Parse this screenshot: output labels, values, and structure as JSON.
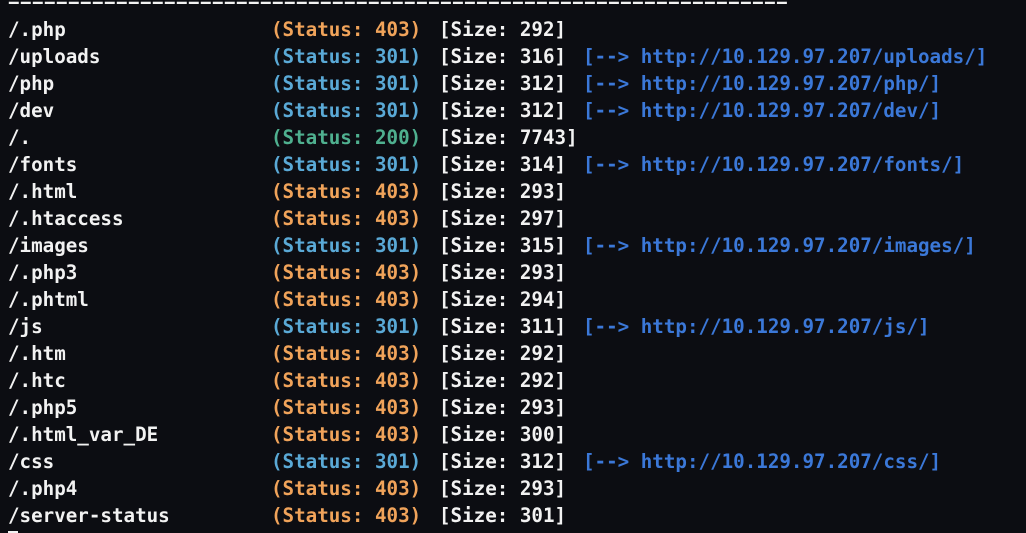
{
  "terminal": {
    "separator": "=================================================================",
    "colors": {
      "background": "#0c0d12",
      "text": "#f2f2f2",
      "status_403": "#f0a35a",
      "status_301": "#5aa9d6",
      "status_200": "#4fb08f",
      "redirect": "#3b78d8"
    },
    "rows": [
      {
        "path": "/.php",
        "status": "(Status: 403)",
        "code": "403",
        "size": "[Size: 292]",
        "redirect": ""
      },
      {
        "path": "/uploads",
        "status": "(Status: 301)",
        "code": "301",
        "size": "[Size: 316]",
        "redirect": "[--> http://10.129.97.207/uploads/]"
      },
      {
        "path": "/php",
        "status": "(Status: 301)",
        "code": "301",
        "size": "[Size: 312]",
        "redirect": "[--> http://10.129.97.207/php/]"
      },
      {
        "path": "/dev",
        "status": "(Status: 301)",
        "code": "301",
        "size": "[Size: 312]",
        "redirect": "[--> http://10.129.97.207/dev/]"
      },
      {
        "path": "/.",
        "status": "(Status: 200)",
        "code": "200",
        "size": "[Size: 7743]",
        "redirect": ""
      },
      {
        "path": "/fonts",
        "status": "(Status: 301)",
        "code": "301",
        "size": "[Size: 314]",
        "redirect": "[--> http://10.129.97.207/fonts/]"
      },
      {
        "path": "/.html",
        "status": "(Status: 403)",
        "code": "403",
        "size": "[Size: 293]",
        "redirect": ""
      },
      {
        "path": "/.htaccess",
        "status": "(Status: 403)",
        "code": "403",
        "size": "[Size: 297]",
        "redirect": ""
      },
      {
        "path": "/images",
        "status": "(Status: 301)",
        "code": "301",
        "size": "[Size: 315]",
        "redirect": "[--> http://10.129.97.207/images/]"
      },
      {
        "path": "/.php3",
        "status": "(Status: 403)",
        "code": "403",
        "size": "[Size: 293]",
        "redirect": ""
      },
      {
        "path": "/.phtml",
        "status": "(Status: 403)",
        "code": "403",
        "size": "[Size: 294]",
        "redirect": ""
      },
      {
        "path": "/js",
        "status": "(Status: 301)",
        "code": "301",
        "size": "[Size: 311]",
        "redirect": "[--> http://10.129.97.207/js/]"
      },
      {
        "path": "/.htm",
        "status": "(Status: 403)",
        "code": "403",
        "size": "[Size: 292]",
        "redirect": ""
      },
      {
        "path": "/.htc",
        "status": "(Status: 403)",
        "code": "403",
        "size": "[Size: 292]",
        "redirect": ""
      },
      {
        "path": "/.php5",
        "status": "(Status: 403)",
        "code": "403",
        "size": "[Size: 293]",
        "redirect": ""
      },
      {
        "path": "/.html_var_DE",
        "status": "(Status: 403)",
        "code": "403",
        "size": "[Size: 300]",
        "redirect": ""
      },
      {
        "path": "/css",
        "status": "(Status: 301)",
        "code": "301",
        "size": "[Size: 312]",
        "redirect": "[--> http://10.129.97.207/css/]"
      },
      {
        "path": "/.php4",
        "status": "(Status: 403)",
        "code": "403",
        "size": "[Size: 293]",
        "redirect": ""
      },
      {
        "path": "/server-status",
        "status": "(Status: 403)",
        "code": "403",
        "size": "[Size: 301]",
        "redirect": ""
      }
    ]
  }
}
